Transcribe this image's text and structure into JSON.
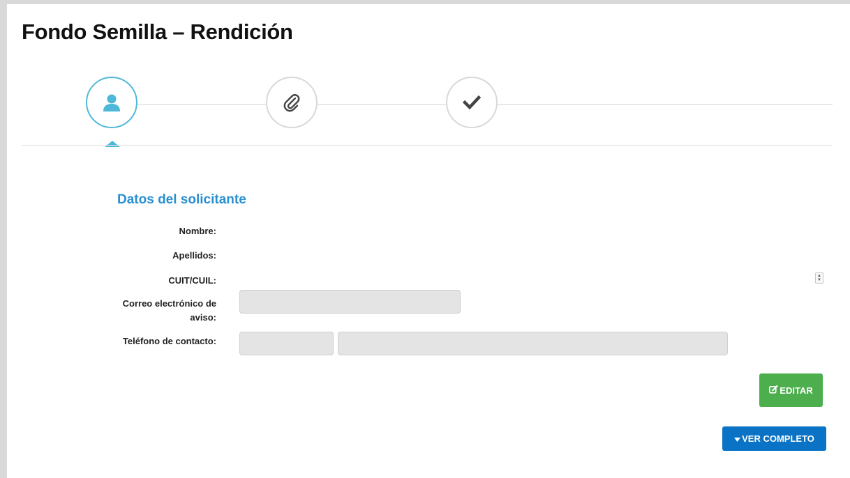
{
  "page": {
    "title": "Fondo Semilla – Rendición"
  },
  "stepper": {
    "steps": [
      {
        "icon": "user-icon",
        "state": "active"
      },
      {
        "icon": "paperclip-icon",
        "state": "pending"
      },
      {
        "icon": "check-icon",
        "state": "pending"
      }
    ],
    "colors": {
      "active": "#4fb8d8",
      "inactive": "#d8d8d8",
      "icon_inactive": "#444444"
    }
  },
  "form": {
    "section_title": "Datos del solicitante",
    "fields": {
      "nombre": {
        "label": "Nombre:",
        "value": ""
      },
      "apellidos": {
        "label": "Apellidos:",
        "value": ""
      },
      "cuit": {
        "label": "CUIT/CUIL:",
        "value": ""
      },
      "correo": {
        "label": "Correo electrónico de aviso:",
        "value": ""
      },
      "telefono": {
        "label": "Teléfono de contacto:",
        "code_value": "",
        "number_value": ""
      }
    }
  },
  "actions": {
    "edit": {
      "label": "EDITAR",
      "icon": "edit-icon",
      "color": "#4cae4c"
    },
    "view_full": {
      "label": "VER COMPLETO",
      "icon": "caret-down-icon",
      "color": "#0a73c5"
    }
  },
  "colors": {
    "section_title": "#2a8fd1",
    "input_background": "#e4e4e4"
  }
}
